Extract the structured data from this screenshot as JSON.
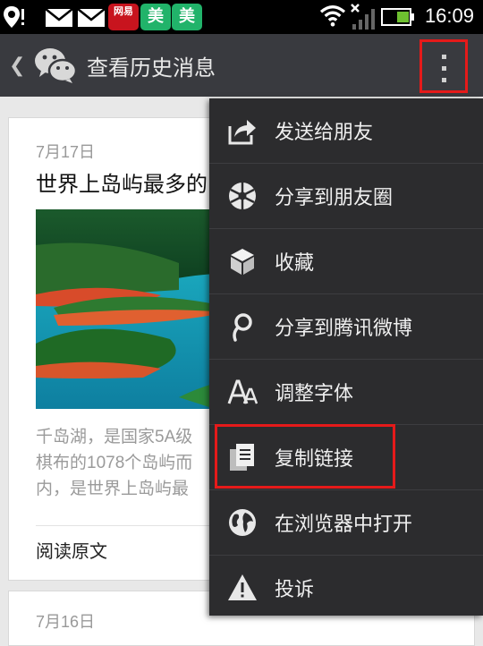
{
  "status_bar": {
    "netease_badge": "网易",
    "mei_badge_1": "美",
    "mei_badge_2": "美",
    "time": "16:09",
    "icons": [
      "location-alert-icon",
      "mail-icon",
      "mail-icon",
      "netease-app-icon",
      "meituan-app-icon",
      "meituan-app-icon",
      "wifi-icon",
      "no-signal-icon",
      "battery-icon"
    ]
  },
  "title_bar": {
    "title": "查看历史消息",
    "back_icon": "chevron-left-icon",
    "logo": "wechat-logo",
    "more_icon": "more-vertical-icon"
  },
  "articles": [
    {
      "date": "7月17日",
      "title": "世界上岛屿最多的",
      "summary_lines": [
        "千岛湖，是国家5A级",
        "棋布的1078个岛屿而",
        "内，是世界上岛屿最"
      ],
      "read_more": "阅读原文"
    },
    {
      "date": "7月16日"
    }
  ],
  "menu": {
    "items": [
      {
        "label": "发送给朋友",
        "icon": "share-forward-icon"
      },
      {
        "label": "分享到朋友圈",
        "icon": "moments-aperture-icon"
      },
      {
        "label": "收藏",
        "icon": "favorite-cube-icon"
      },
      {
        "label": "分享到腾讯微博",
        "icon": "tencent-weibo-icon"
      },
      {
        "label": "调整字体",
        "icon": "font-size-icon"
      },
      {
        "label": "复制链接",
        "icon": "copy-link-icon"
      },
      {
        "label": "在浏览器中打开",
        "icon": "globe-icon"
      },
      {
        "label": "投诉",
        "icon": "warning-icon"
      }
    ]
  },
  "colors": {
    "title_bar_bg": "#393a3f",
    "menu_bg": "#2c2c2e",
    "highlight": "#e51a1a"
  }
}
